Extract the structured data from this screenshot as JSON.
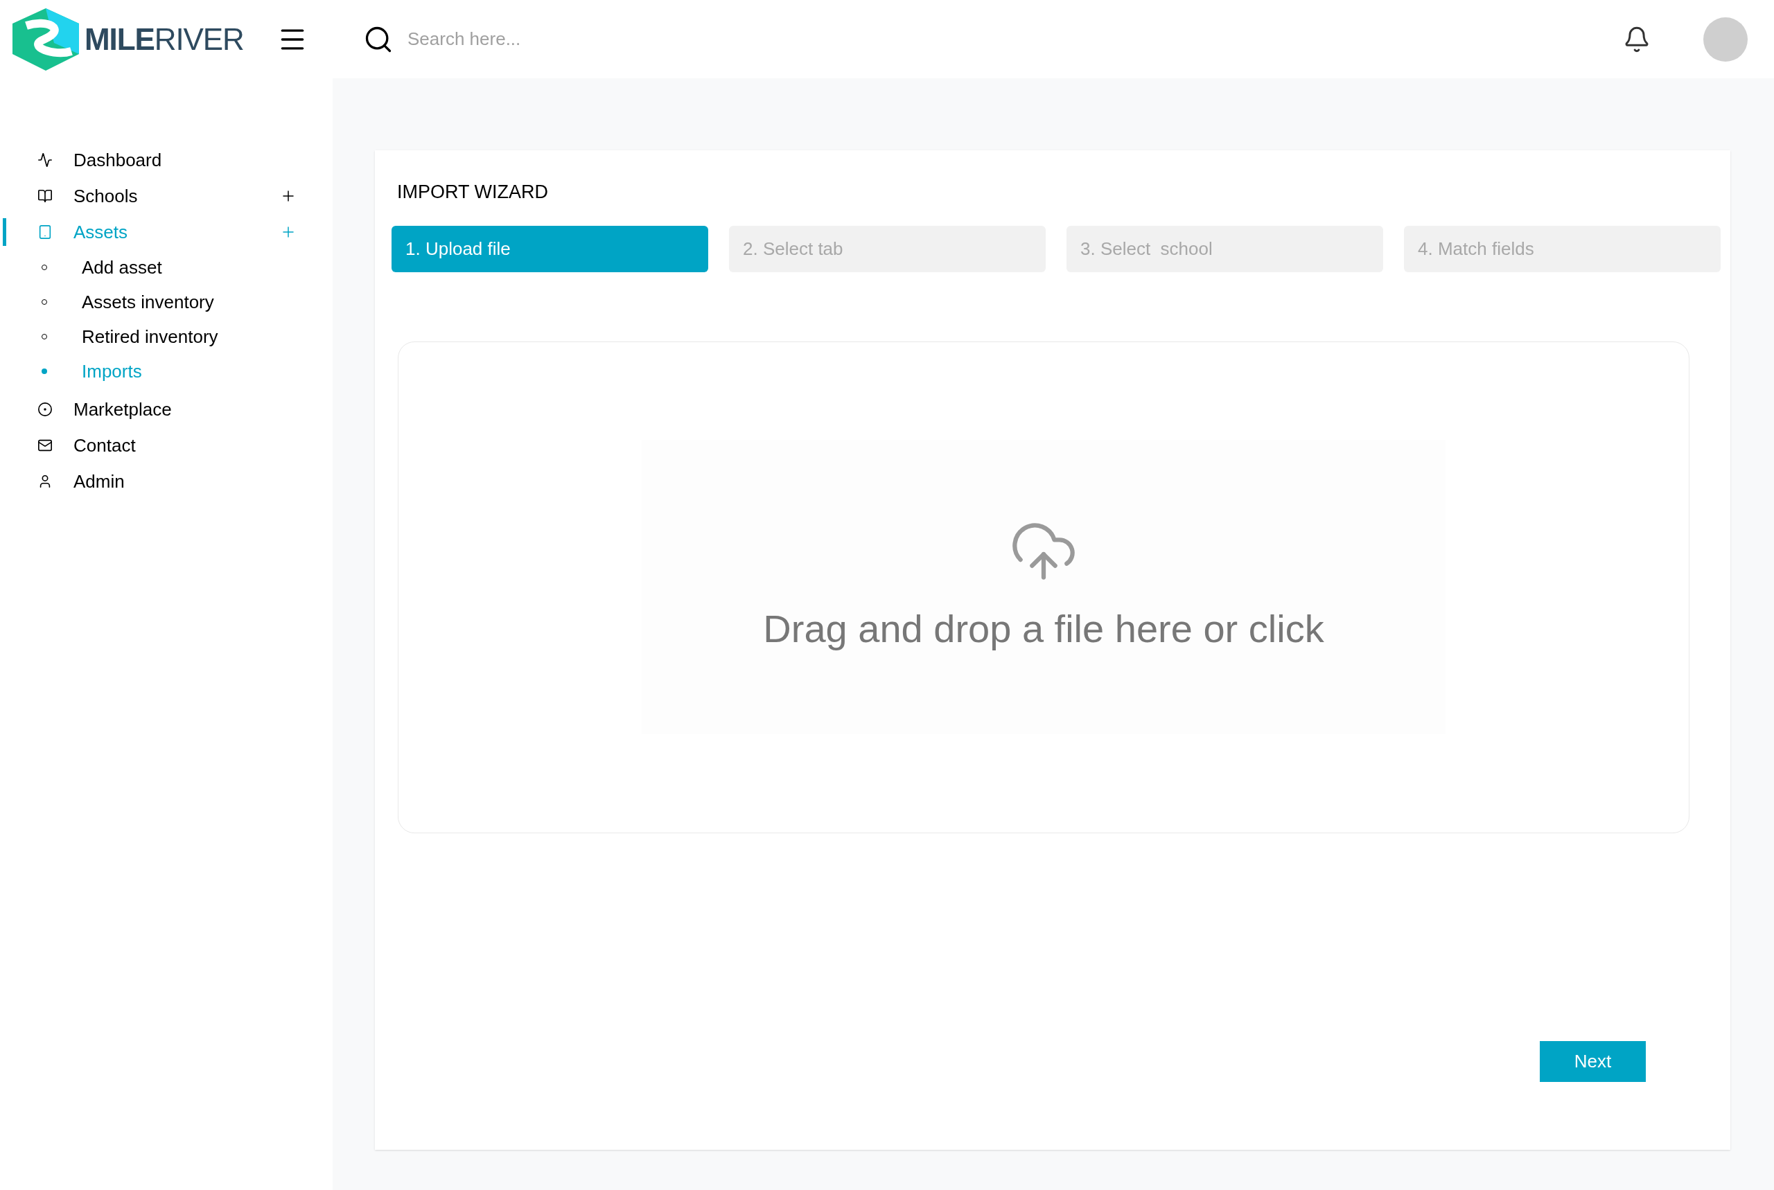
{
  "logo": {
    "text": "**MILE**RIVER"
  },
  "search": {
    "placeholder": "Search here..."
  },
  "sidebar": {
    "items": [
      {
        "label": "Dashboard",
        "selected": false,
        "addable": false
      },
      {
        "label": "Schools",
        "selected": false,
        "addable": true
      },
      {
        "label": "Assets",
        "selected": true,
        "addable": true,
        "expanded": true,
        "children": [
          {
            "label": "Add asset",
            "selected": false
          },
          {
            "label": "Assets inventory",
            "selected": false
          },
          {
            "label": "Retired inventory",
            "selected": false
          },
          {
            "label": "Imports",
            "selected": true
          }
        ]
      },
      {
        "label": "Marketplace",
        "selected": false,
        "addable": false
      },
      {
        "label": "Contact",
        "selected": false,
        "addable": false
      },
      {
        "label": "Admin",
        "selected": false,
        "addable": false
      }
    ]
  },
  "wizard": {
    "title": "IMPORT WIZARD",
    "steps": [
      {
        "label": "1. Upload file",
        "selected": true
      },
      {
        "label": "2. Select tab",
        "selected": false
      },
      {
        "label": "3. Select  school",
        "selected": false
      },
      {
        "label": "4. Match fields",
        "selected": false
      }
    ],
    "dropzone": {
      "text": "Drag and drop a file here or click"
    },
    "next_button": "Next"
  }
}
